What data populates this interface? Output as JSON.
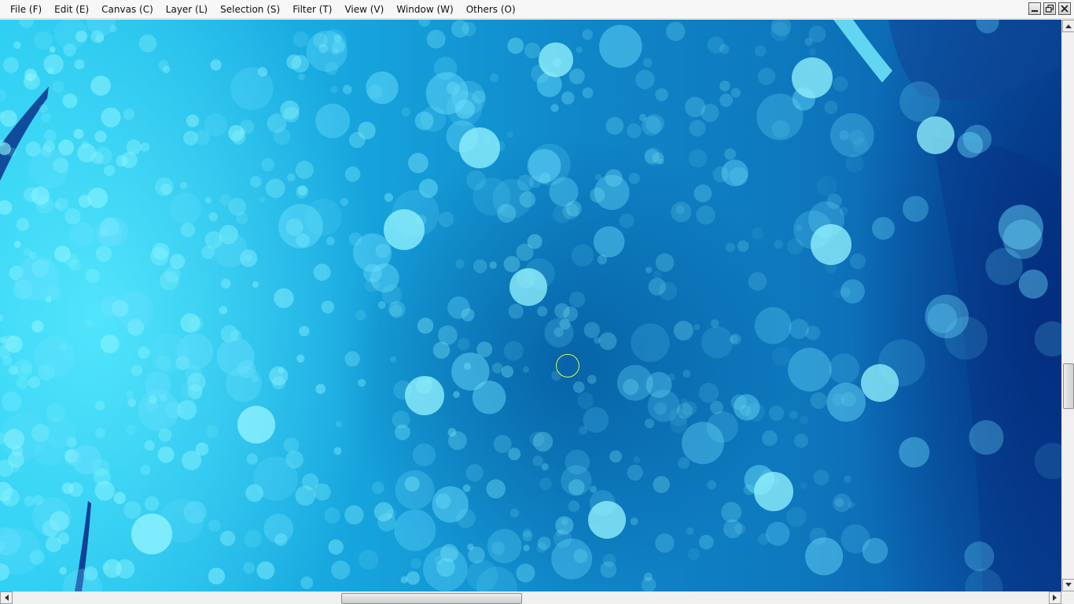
{
  "menubar": {
    "items": [
      {
        "label": "File (F)"
      },
      {
        "label": "Edit (E)"
      },
      {
        "label": "Canvas (C)"
      },
      {
        "label": "Layer (L)"
      },
      {
        "label": "Selection (S)"
      },
      {
        "label": "Filter (T)"
      },
      {
        "label": "View (V)"
      },
      {
        "label": "Window (W)"
      },
      {
        "label": "Others (O)"
      }
    ]
  },
  "window_controls": {
    "icons": [
      "minimize-icon",
      "restore-icon",
      "close-icon"
    ]
  },
  "canvas": {
    "image_description_colors": {
      "light_cyan": "#5fe6ff",
      "mid_blue": "#1298d6",
      "deep_blue": "#0a4e9c"
    },
    "brush_cursor_color": "#d7ff6a"
  },
  "scrollbars": {
    "vertical_position": 0.61,
    "horizontal_position": 0.37
  }
}
